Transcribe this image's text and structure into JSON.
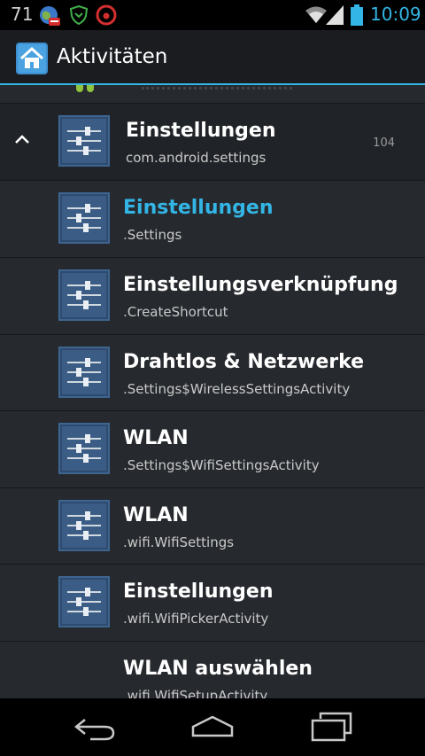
{
  "status_bar": {
    "notification_count": "71",
    "time": "10:09",
    "icons": [
      "globe-off-icon",
      "shield-icon",
      "vodafone-icon",
      "wifi-icon",
      "signal-icon",
      "battery-icon"
    ]
  },
  "action_bar": {
    "title": "Aktivitäten",
    "icon": "home-icon"
  },
  "list": {
    "parent": {
      "title": "Einstellungen",
      "package": "com.android.settings",
      "count": "104",
      "expand_icon": "chevron-up-icon"
    },
    "items": [
      {
        "title": "Einstellungen",
        "subtitle": ".Settings",
        "highlighted": true
      },
      {
        "title": "Einstellungsverknüpfung",
        "subtitle": ".CreateShortcut"
      },
      {
        "title": "Drahtlos & Netzwerke",
        "subtitle": ".Settings$WirelessSettingsActivity"
      },
      {
        "title": "WLAN",
        "subtitle": ".Settings$WifiSettingsActivity"
      },
      {
        "title": "WLAN",
        "subtitle": ".wifi.WifiSettings"
      },
      {
        "title": "Einstellungen",
        "subtitle": ".wifi.WifiPickerActivity"
      },
      {
        "title": "WLAN auswählen",
        "subtitle": ".wifi.WifiSetupActivity"
      }
    ]
  },
  "nav_bar": {
    "icons": [
      "back-icon",
      "home-nav-icon",
      "recent-apps-icon"
    ]
  },
  "colors": {
    "accent": "#33b5e5",
    "list_background": "#26292e",
    "action_bar": "#1a1c20"
  }
}
